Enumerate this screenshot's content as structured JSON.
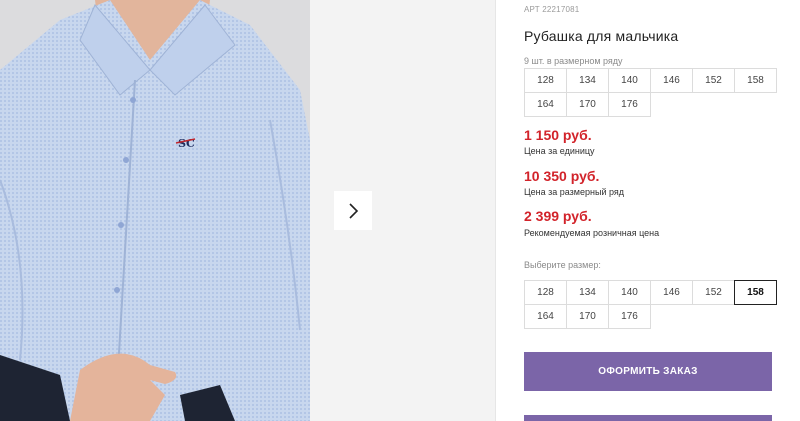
{
  "product": {
    "sku": "АРТ 22217081",
    "title": "Рубашка для мальчика",
    "row_note": "9 шт. в размерном ряду",
    "size_row": [
      "128",
      "134",
      "140",
      "146",
      "152",
      "158",
      "164",
      "170",
      "176"
    ]
  },
  "prices": [
    {
      "value": "1 150 руб.",
      "label": "Цена за единицу"
    },
    {
      "value": "10 350 руб.",
      "label": "Цена за размерный ряд"
    },
    {
      "value": "2 399 руб.",
      "label": "Рекомендуемая розничная цена"
    }
  ],
  "size_picker": {
    "label": "Выберите размер:",
    "sizes": [
      "128",
      "134",
      "140",
      "146",
      "152",
      "158",
      "164",
      "170",
      "176"
    ],
    "selected": "158"
  },
  "actions": {
    "order_label": "ОФОРМИТЬ ЗАКАЗ"
  },
  "gallery": {
    "next_icon": "chevron-right-icon",
    "shirt_logo": "SC"
  },
  "colors": {
    "accent": "#7b65a8",
    "price": "#d2232a"
  }
}
